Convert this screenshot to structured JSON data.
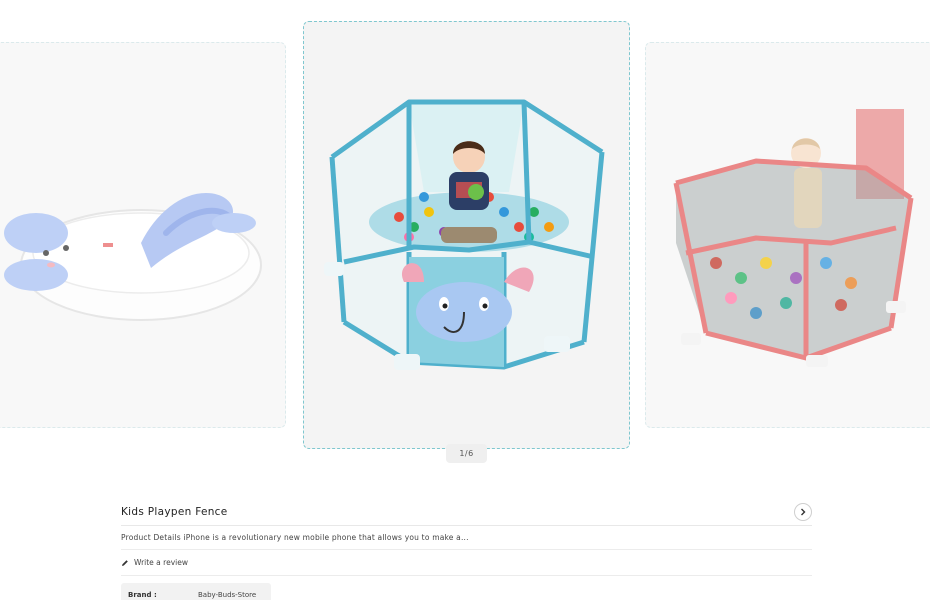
{
  "carousel": {
    "slides": [
      {
        "name": "baby-bathtub",
        "image": "blue-white-bathtub-icon"
      },
      {
        "name": "kids-playpen-blue",
        "image": "blue-elephant-playpen-icon"
      },
      {
        "name": "kids-playpen-red",
        "image": "red-playpen-icon"
      }
    ],
    "counter": "1/6",
    "accent": "#7fc7cf"
  },
  "product": {
    "title": "Kids Playpen Fence",
    "description": "Product Details iPhone is a revolutionary new mobile phone that allows you to make a...",
    "review_label": "Write a review",
    "brand_label": "Brand :",
    "brand_value": "Baby-Buds-Store"
  }
}
